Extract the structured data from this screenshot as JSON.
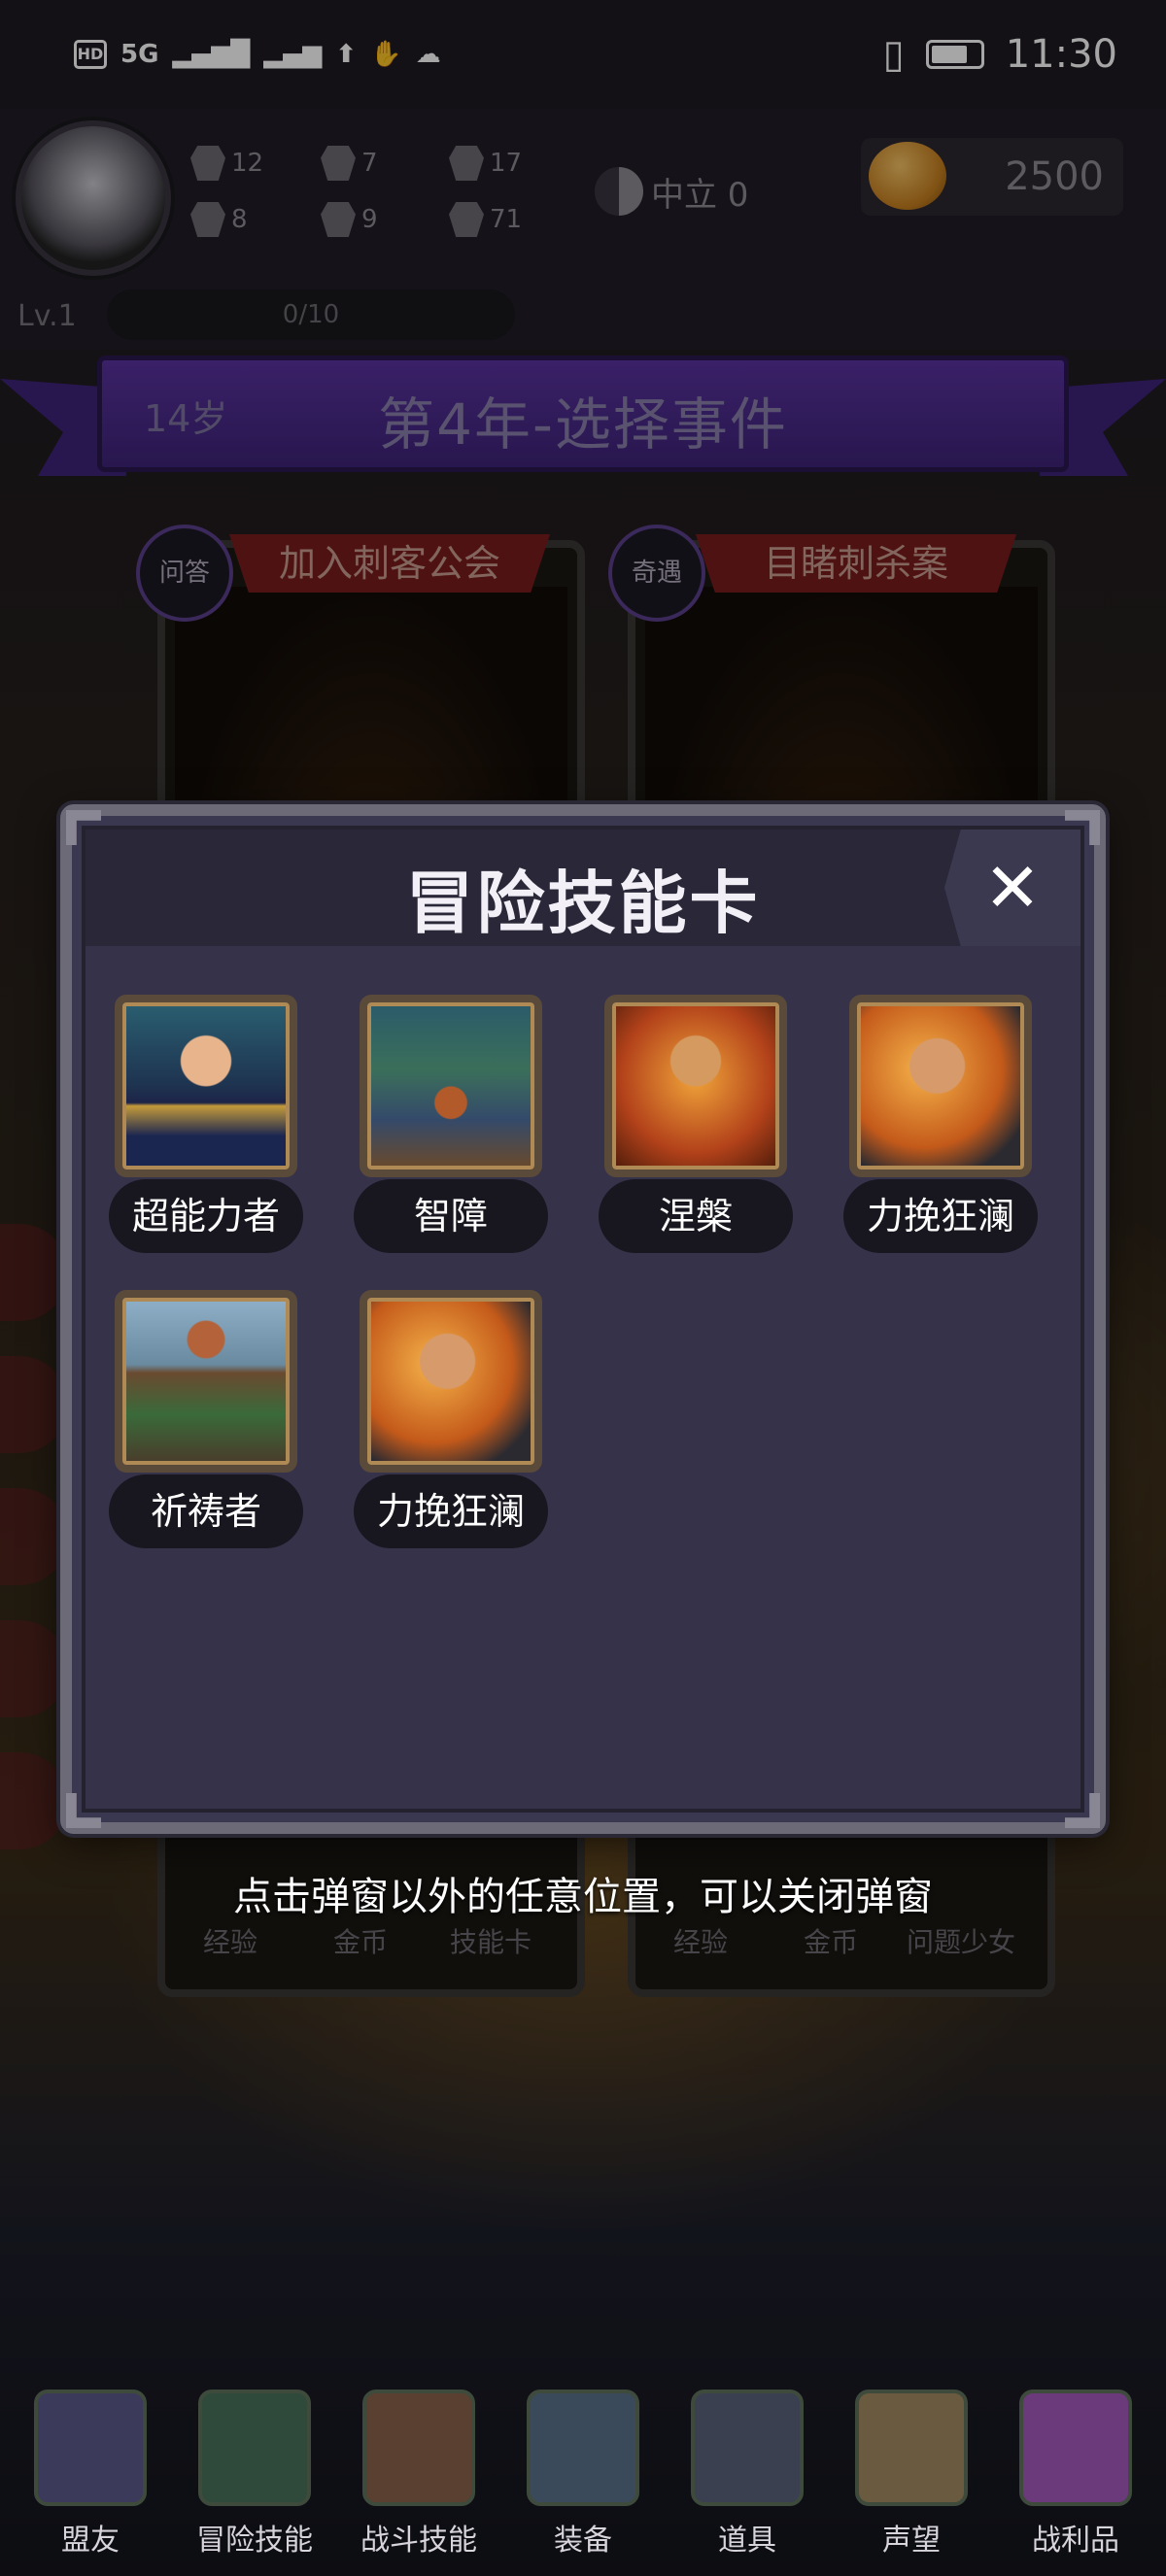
{
  "status_bar": {
    "time": "11:30",
    "hd": "HD",
    "network": "5G"
  },
  "header": {
    "stats": [
      {
        "icon": "fist-icon",
        "value": "12"
      },
      {
        "icon": "quill-icon",
        "value": "7"
      },
      {
        "icon": "wizard-hat-icon",
        "value": "17"
      },
      {
        "icon": "clover-icon",
        "value": "8"
      },
      {
        "icon": "scroll-icon",
        "value": "9"
      },
      {
        "icon": "lotus-icon",
        "value": "71"
      }
    ],
    "alignment": "中立 0",
    "gold": "2500",
    "level": "Lv.1",
    "xp": "0/10"
  },
  "banner": {
    "age": "14岁",
    "title": "第4年-选择事件"
  },
  "events": [
    {
      "badge": "问答",
      "title": "加入刺客公会",
      "rewards": [
        "经验",
        "金币",
        "技能卡"
      ]
    },
    {
      "badge": "奇遇",
      "title": "目睹刺杀案",
      "rewards": [
        "经验",
        "金币",
        "问题少女"
      ]
    }
  ],
  "modal": {
    "title": "冒险技能卡",
    "close": "✕",
    "skills": [
      "超能力者",
      "智障",
      "涅槃",
      "力挽狂澜",
      "祈祷者",
      "力挽狂澜"
    ]
  },
  "hint": "点击弹窗以外的任意位置，可以关闭弹窗",
  "nav": [
    "盟友",
    "冒险技能",
    "战斗技能",
    "装备",
    "道具",
    "声望",
    "战利品"
  ]
}
